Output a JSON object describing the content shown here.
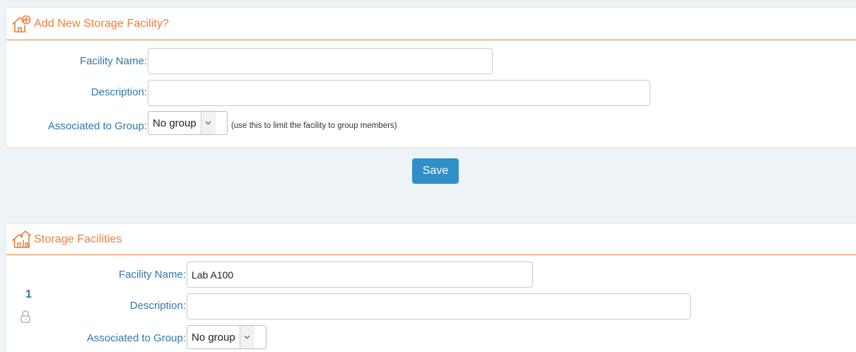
{
  "add_panel": {
    "title": "Add New Storage Facility?",
    "icon": "house-plus-icon",
    "facility_name_label": "Facility Name:",
    "facility_name_value": "",
    "description_label": "Description:",
    "description_value": "",
    "group_label": "Associated to Group:",
    "group_selected": "No group",
    "group_hint": "(use this to limit the facility to group members)"
  },
  "save_label": "Save",
  "list_panel": {
    "title": "Storage Facilities",
    "icon": "houses-icon",
    "items": [
      {
        "number": "1",
        "locked_icon": "lock-icon",
        "facility_name_label": "Facility Name:",
        "facility_name_value": "Lab A100",
        "description_label": "Description:",
        "description_value": "",
        "group_label": "Associated to Group:",
        "group_selected": "No group"
      }
    ]
  },
  "colors": {
    "accent_orange": "#f07c38",
    "label_blue": "#2f79a9",
    "button_blue": "#2f8fc7",
    "background": "#eef3f7"
  }
}
